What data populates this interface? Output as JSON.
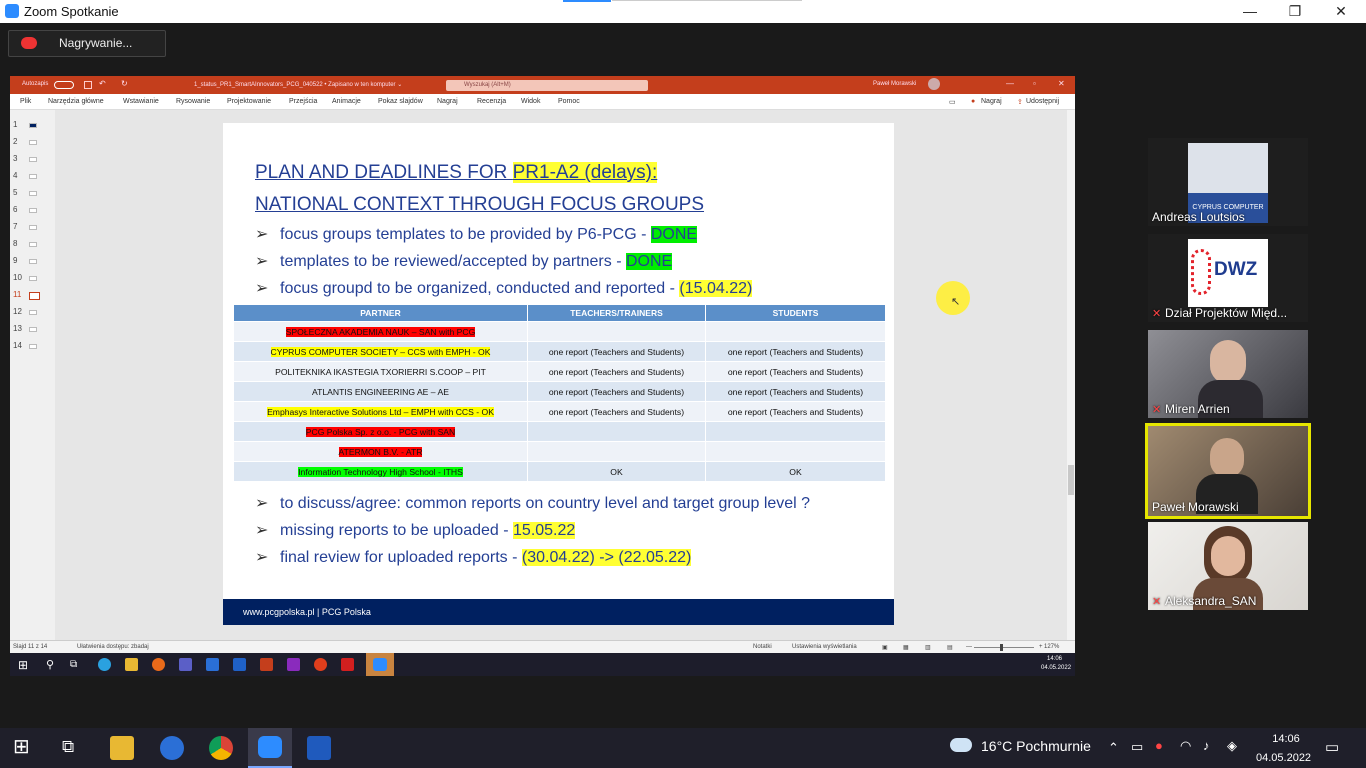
{
  "window": {
    "title": "Zoom Spotkanie"
  },
  "recording": {
    "label": "Nagrywanie..."
  },
  "ppt": {
    "autosave": "Autozapis",
    "filename": "1_status_PR1_SmartAInnovators_PCG_040522 • Zapisano w ten komputer ⌄",
    "search": "Wyszukaj (Alt+M)",
    "user": "Paweł Morawski",
    "menu": [
      "Plik",
      "Narzędzia główne",
      "Wstawianie",
      "Rysowanie",
      "Projektowanie",
      "Przejścia",
      "Animacje",
      "Pokaz slajdów",
      "Nagraj",
      "Recenzja",
      "Widok",
      "Pomoc"
    ],
    "record_btn": "Nagraj",
    "share_btn": "Udostępnij",
    "thumbs": [
      "1",
      "2",
      "3",
      "4",
      "5",
      "6",
      "7",
      "8",
      "9",
      "10",
      "11",
      "12",
      "13",
      "14"
    ]
  },
  "slide": {
    "title1a": "PLAN AND DEADLINES FOR ",
    "title1b": "PR1-A2 (delays):",
    "title2": "NATIONAL CONTEXT THROUGH FOCUS GROUPS",
    "b1a": "focus groups templates to be provided by P6-PCG - ",
    "b1b": "DONE",
    "b2a": "templates to be reviewed/accepted by partners - ",
    "b2b": "DONE",
    "b3a": "focus groupd to be organized, conducted and reported - ",
    "b3b": "(15.04.22)",
    "headers": [
      "PARTNER",
      "TEACHERS/TRAINERS",
      "STUDENTS"
    ],
    "rows": [
      {
        "p": "SPOŁECZNA AKADEMIA NAUK – SAN with PCG",
        "t": "",
        "s": ""
      },
      {
        "p": "CYPRUS COMPUTER SOCIETY – CCS with EMPH - OK",
        "t": "one report (Teachers and Students)",
        "s": "one report (Teachers and Students)"
      },
      {
        "p": "POLITEKNIKA IKASTEGIA TXORIERRI S.COOP – PIT",
        "t": "one report (Teachers and Students)",
        "s": "one report (Teachers and Students)"
      },
      {
        "p": "ATLANTIS ENGINEERING AE – AE",
        "t": "one report (Teachers and Students)",
        "s": "one report (Teachers and Students)"
      },
      {
        "p": "Emphasys Interactive Solutions Ltd – EMPH with CCS - OK",
        "t": "one report (Teachers and Students)",
        "s": "one report (Teachers and Students)"
      },
      {
        "p": "PCG Polska Sp. z o.o. - PCG with SAN",
        "t": "",
        "s": ""
      },
      {
        "p": "ATERMON B.V. - ATR",
        "t": "",
        "s": ""
      },
      {
        "p": "Information Technology High School - ITHS",
        "t": "OK",
        "s": "OK"
      }
    ],
    "b4": "to discuss/agree: common reports on country level and target group level ?",
    "b5a": "missing reports to be uploaded - ",
    "b5b": "15.05.22",
    "b6a": "final review for uploaded reports - ",
    "b6b": "(30.04.22) -> (22.05.22)",
    "footer": "www.pcgpolska.pl | PCG Polska"
  },
  "status": {
    "slide": "Slajd 11 z 14",
    "access": "Ułatwienia dostępu: zbadaj",
    "notes": "Notatki",
    "display": "Ustawienia wyświetlania",
    "zoom": "127%"
  },
  "inner_clock": {
    "time": "14:06",
    "date": "04.05.2022"
  },
  "participants": [
    {
      "name": "Andreas Loutsios",
      "logo": "CYPRUS COMPUTER"
    },
    {
      "name": "Dział Projektów Międ...",
      "logo": "DWZ"
    },
    {
      "name": "Miren Arrien"
    },
    {
      "name": "Paweł Morawski"
    },
    {
      "name": "Aleksandra_SAN"
    }
  ],
  "taskbar": {
    "weather": "16°C  Pochmurnie",
    "time": "14:06",
    "date": "04.05.2022"
  },
  "colors": {
    "ppt_red": "#c43e1c",
    "zoom_blue": "#2d8cff",
    "slide_blue": "#243f94",
    "table_header": "#5b8fc9",
    "footer_navy": "#002060",
    "active_speaker": "#e6e600"
  }
}
